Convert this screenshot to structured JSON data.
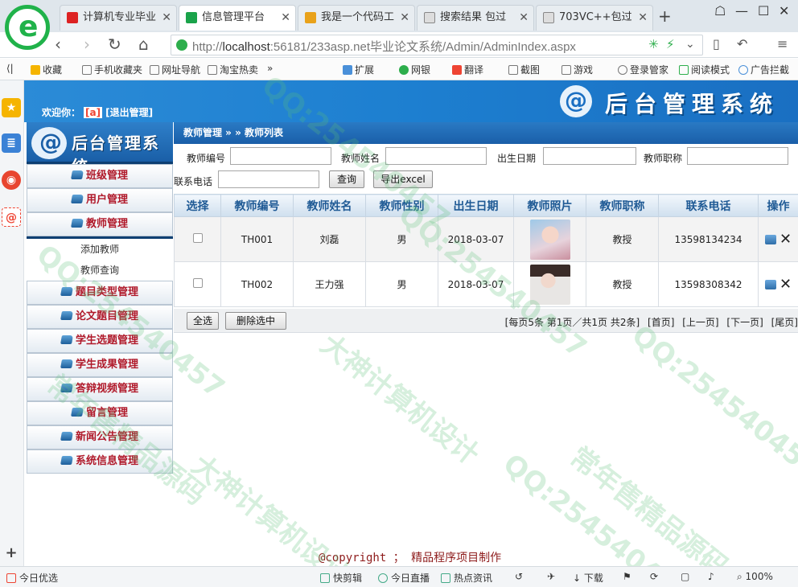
{
  "browser": {
    "tabs": [
      {
        "title": "计算机专业毕业",
        "color": "#d22"
      },
      {
        "title": "信息管理平台",
        "color": "#1aa34a"
      },
      {
        "title": "我是一个代码工",
        "color": "#e9a21a"
      },
      {
        "title": "搜索结果 包过",
        "color": "#888"
      },
      {
        "title": "703VC++包过",
        "color": "#888"
      }
    ],
    "tab_close": "✕",
    "new_tab": "+",
    "url_host": "http://",
    "url_main": "localhost",
    "url_rest": ":56181/233asp.net毕业论文系统/Admin/AdminIndex.aspx",
    "bookmarks": [
      "收藏",
      "手机收藏夹",
      "网址导航",
      "淘宝热卖",
      "扩展",
      "网银",
      "翻译",
      "截图",
      "游戏",
      "登录管家",
      "阅读模式",
      "广告拦截"
    ],
    "status_items": [
      "今日优选",
      "快剪辑",
      "今日直播",
      "热点资讯",
      "下载",
      "100%"
    ]
  },
  "header": {
    "welcome_label": "欢迎你：",
    "user": "[a]",
    "logout": "[退出管理]",
    "system_title": "后台管理系统"
  },
  "menu": {
    "title": "后台管理系统",
    "items_top": [
      "班级管理",
      "用户管理",
      "教师管理"
    ],
    "sub_items": [
      "添加教师",
      "教师查询"
    ],
    "items_bottom": [
      "题目类型管理",
      "论文题目管理",
      "学生选题管理",
      "学生成果管理",
      "答辩视频管理",
      "留言管理",
      "新闻公告管理",
      "系统信息管理"
    ]
  },
  "main": {
    "breadcrumb": "教师管理 » » 教师列表",
    "search": {
      "teacher_no": "教师编号",
      "teacher_name": "教师姓名",
      "birth_date": "出生日期",
      "title": "教师职称",
      "phone": "联系电话",
      "query": "查询",
      "export": "导出excel"
    },
    "table": {
      "headers": [
        "选择",
        "教师编号",
        "教师姓名",
        "教师性别",
        "出生日期",
        "教师照片",
        "教师职称",
        "联系电话",
        "操作"
      ],
      "rows": [
        {
          "no": "TH001",
          "name": "刘磊",
          "gender": "男",
          "birth": "2018-03-07",
          "title": "教授",
          "phone": "13598134234"
        },
        {
          "no": "TH002",
          "name": "王力强",
          "gender": "男",
          "birth": "2018-03-07",
          "title": "教授",
          "phone": "13598308342"
        }
      ]
    },
    "select_all": "全选",
    "delete_selected": "删除选中",
    "pager": {
      "info": "[每页5条 第1页／共1页 共2条]",
      "first": "[首页]",
      "prev": "[上一页]",
      "next": "[下一页]",
      "last": "[尾页]"
    },
    "copyright": "@copyright ； 精品程序项目制作"
  },
  "watermark": {
    "qq": "QQ:254540457",
    "slogan_a": "大神计算机设计",
    "slogan_b": "常年售精品源码"
  }
}
